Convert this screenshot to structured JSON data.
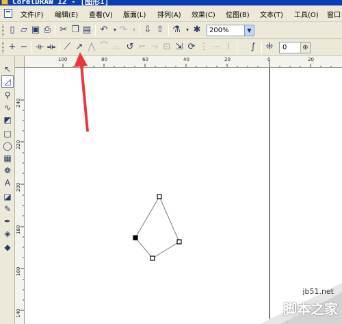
{
  "window": {
    "title": "CorelDRAW 12 - [图形1]"
  },
  "menu": {
    "items": [
      "文件(F)",
      "编辑(E)",
      "查看(V)",
      "版面(L)",
      "排列(A)",
      "效果(C)",
      "位图(B)",
      "文本(T)",
      "工具(O)",
      "窗口"
    ]
  },
  "toolbar": {
    "zoom_value": "200%"
  },
  "property_bar": {
    "nudge_value": "0"
  },
  "ruler": {
    "top_labels": [
      "100",
      "80",
      "60",
      "40",
      "20",
      "0",
      "20"
    ],
    "left_labels": [
      "240",
      "220",
      "200",
      "180",
      "160",
      "140"
    ]
  },
  "colors": {
    "accent_arrow": "#e8383c",
    "title_bar": "#0a3cb4",
    "chrome": "#ece9d8"
  },
  "watermark": {
    "url": "jb51.net",
    "brand": "脚本之家"
  }
}
